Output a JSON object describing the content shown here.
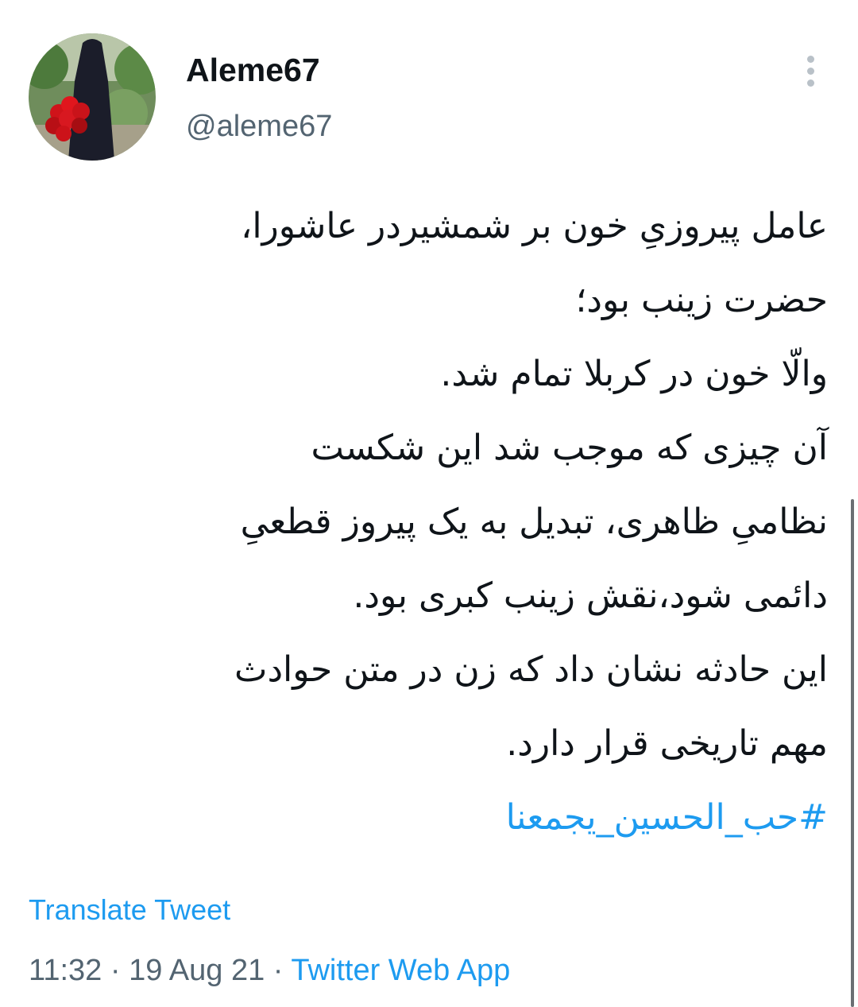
{
  "user": {
    "display_name": "Aleme67",
    "handle": "@aleme67",
    "avatar_icon": "profile-photo"
  },
  "menu": {
    "more_icon": "more-vertical-icon"
  },
  "tweet": {
    "lines": [
      "عامل پیروزیِ خون بر شمشیردر عاشورا،",
      "حضرت زینب بود؛",
      "والّا خون در کربلا تمام شد.",
      " آن چیزی که موجب شد این شکست",
      "نظامیِ ظاهری، تبدیل به یک پیروز قطعیِ",
      "دائمی شود،نقش زینب کبری بود.",
      "این حادثه نشان داد که زن در متن حوادث",
      "مهم تاریخی قرار دارد."
    ],
    "hashtag": "#حب_الحسین_یجمعنا"
  },
  "translate_label": "Translate Tweet",
  "meta": {
    "time": "11:32",
    "separator": " · ",
    "date": "19 Aug 21",
    "source": "Twitter Web App"
  },
  "colors": {
    "link": "#1d9bf0",
    "secondary_text": "#536471",
    "primary_text": "#0f1419"
  }
}
